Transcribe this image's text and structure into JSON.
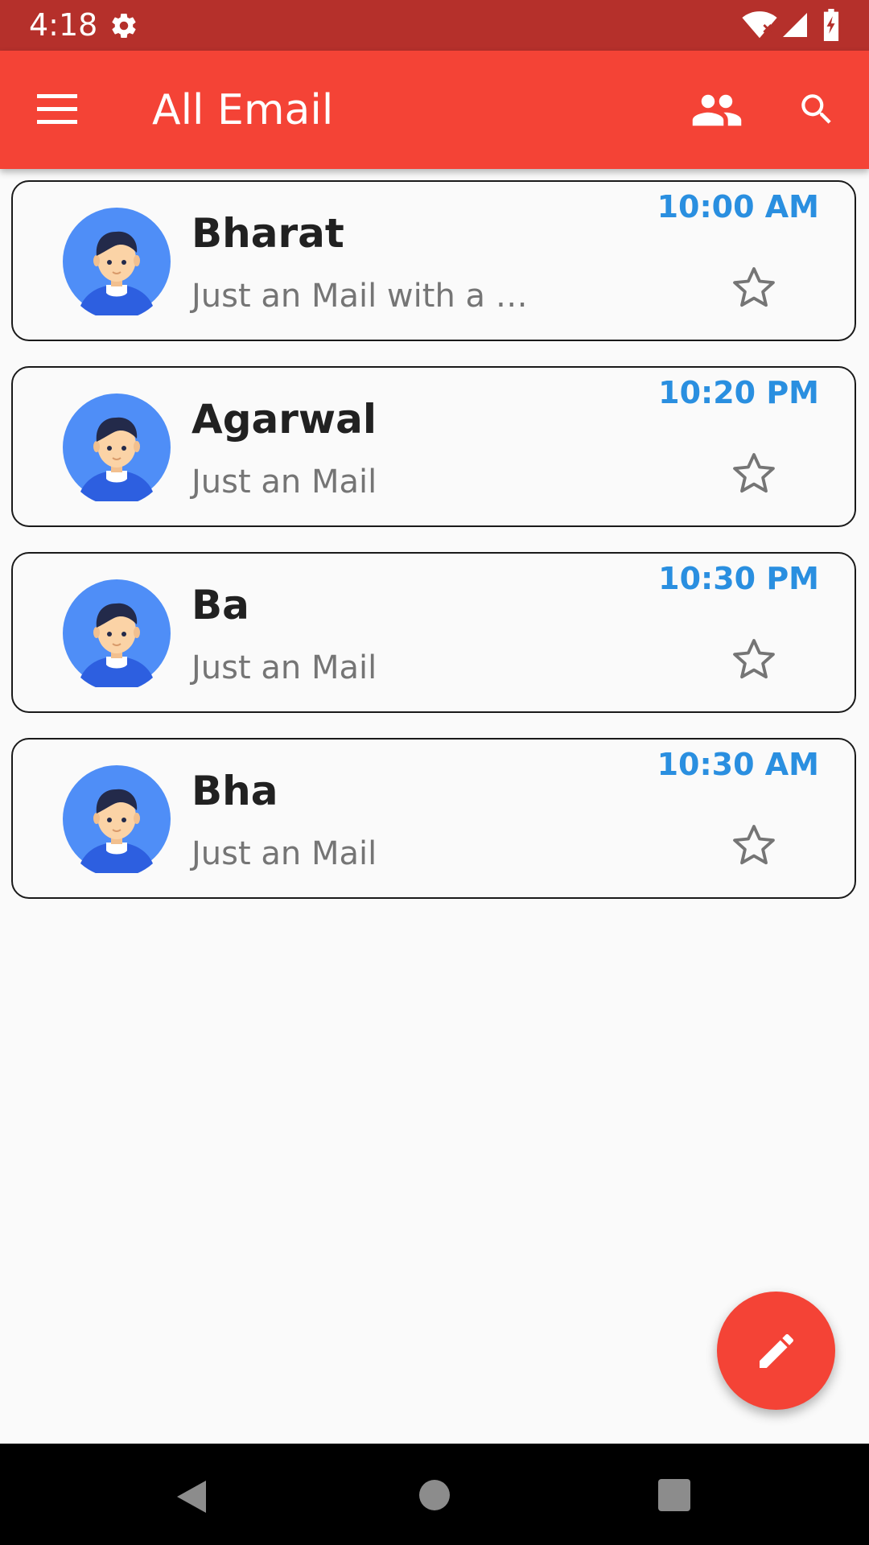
{
  "status_bar": {
    "time": "4:18",
    "icons": [
      "settings-gear-icon",
      "wifi-icon",
      "signal-icon",
      "battery-icon"
    ]
  },
  "app_bar": {
    "title": "All Email",
    "icons": [
      "menu-icon",
      "people-icon",
      "search-icon"
    ]
  },
  "emails": [
    {
      "sender": "Bharat",
      "preview": "Just an Mail with a …",
      "time": "10:00 AM",
      "starred": false
    },
    {
      "sender": "Agarwal",
      "preview": "Just an Mail",
      "time": "10:20 PM",
      "starred": false
    },
    {
      "sender": "Ba",
      "preview": "Just an Mail",
      "time": "10:30 PM",
      "starred": false
    },
    {
      "sender": "Bha",
      "preview": "Just an Mail",
      "time": "10:30 AM",
      "starred": false
    }
  ],
  "fab": {
    "icon": "pencil-edit-icon"
  },
  "nav_bar": {
    "icons": [
      "back-icon",
      "home-icon",
      "recents-icon"
    ]
  },
  "colors": {
    "status_bar": "#b5302b",
    "app_bar": "#f44336",
    "time_accent": "#2a8fe0",
    "avatar_bg": "#4f8ef7",
    "background": "#fafafa"
  }
}
